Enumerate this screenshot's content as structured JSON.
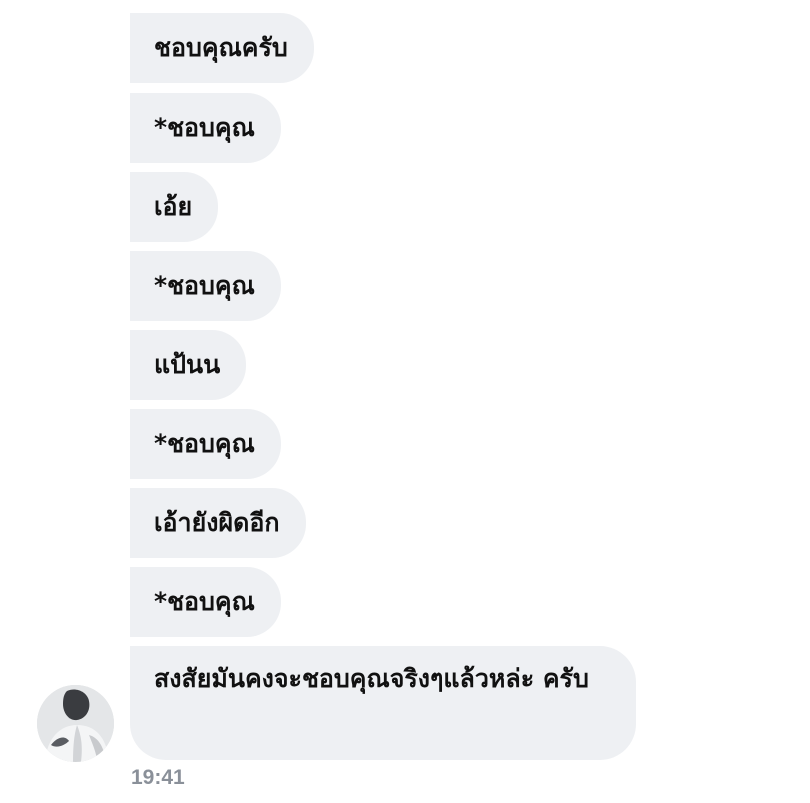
{
  "messages": [
    {
      "text": "ชอบคุณครับ"
    },
    {
      "text": "*ชอบคุณ"
    },
    {
      "text": "เอ้ย"
    },
    {
      "text": "*ชอบคุณ"
    },
    {
      "text": "แป้นน"
    },
    {
      "text": "*ชอบคุณ"
    },
    {
      "text": "เอ้ายังผิดอีก"
    },
    {
      "text": "*ชอบคุณ"
    },
    {
      "text": "สงสัยมันคงจะชอบคุณจริงๆแล้วหล่ะ ครับ"
    }
  ],
  "timestamp": "19:41",
  "colors": {
    "bubble_bg": "#eef0f3",
    "text": "#111111",
    "timestamp": "#8a9099",
    "background": "#ffffff"
  },
  "avatar": {
    "icon": "sender-avatar-photo"
  }
}
